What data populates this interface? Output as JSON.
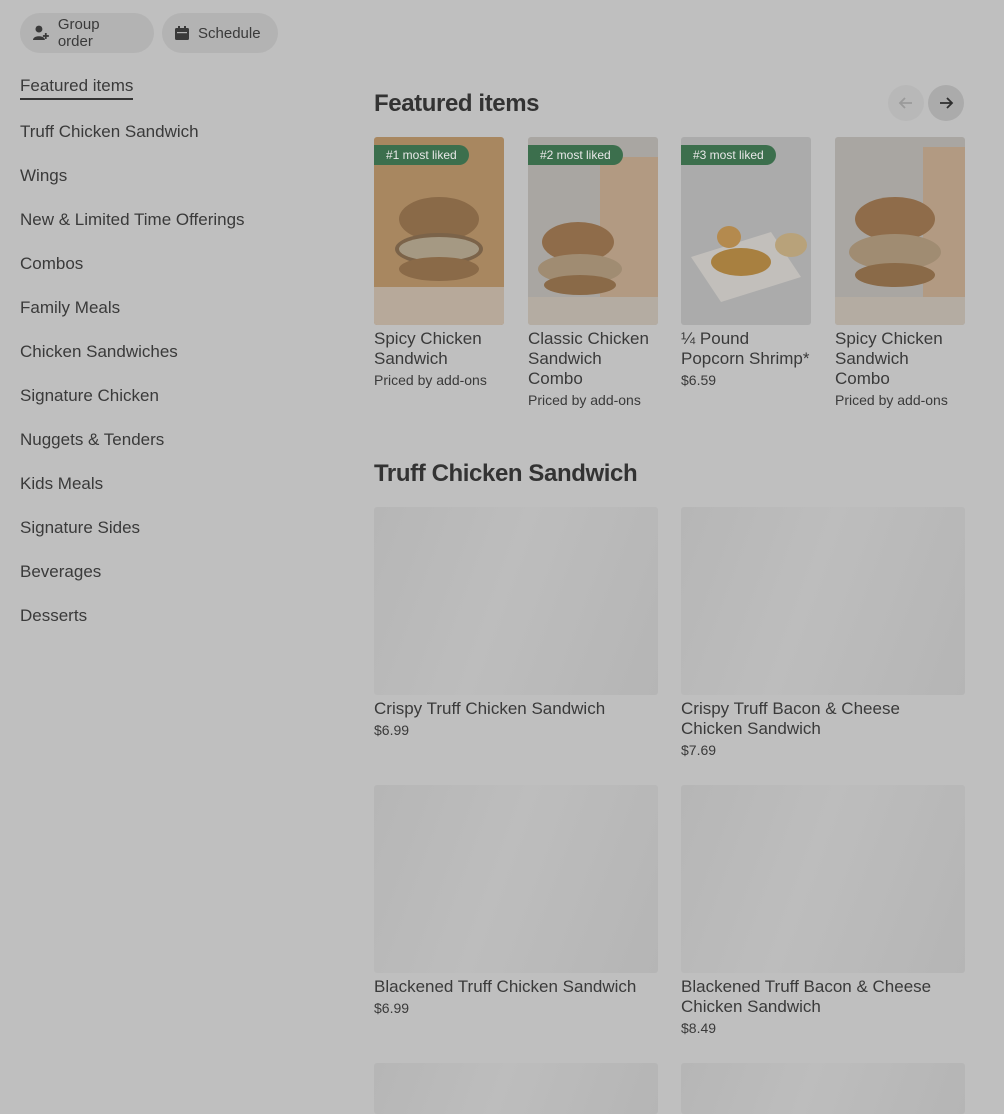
{
  "header": {
    "group_order_label": "Group order",
    "schedule_label": "Schedule"
  },
  "sidebar": {
    "items": [
      {
        "label": "Featured items",
        "active": true
      },
      {
        "label": "Truff Chicken Sandwich"
      },
      {
        "label": "Wings"
      },
      {
        "label": "New & Limited Time Offerings"
      },
      {
        "label": "Combos"
      },
      {
        "label": "Family Meals"
      },
      {
        "label": "Chicken Sandwiches"
      },
      {
        "label": "Signature Chicken"
      },
      {
        "label": "Nuggets & Tenders"
      },
      {
        "label": "Kids Meals"
      },
      {
        "label": "Signature Sides"
      },
      {
        "label": "Beverages"
      },
      {
        "label": "Desserts"
      }
    ]
  },
  "featured": {
    "title": "Featured items",
    "items": [
      {
        "badge": "#1 most liked",
        "name": "Spicy Chicken Sandwich",
        "price": "Priced by add-ons"
      },
      {
        "badge": "#2 most liked",
        "name": "Classic Chicken Sandwich Combo",
        "price": "Priced by add-ons"
      },
      {
        "badge": "#3 most liked",
        "name": "¼ Pound Popcorn Shrimp*",
        "price": "$6.59"
      },
      {
        "badge": "",
        "name": "Spicy Chicken Sandwich Combo",
        "price": "Priced by add-ons"
      }
    ]
  },
  "section": {
    "title": "Truff Chicken Sandwich",
    "items": [
      {
        "name": "Crispy Truff Chicken Sandwich",
        "price": "$6.99"
      },
      {
        "name": "Crispy Truff Bacon & Cheese Chicken Sandwich",
        "price": "$7.69"
      },
      {
        "name": "Blackened Truff Chicken Sandwich",
        "price": "$6.99"
      },
      {
        "name": "Blackened Truff Bacon & Cheese Chicken Sandwich",
        "price": "$8.49"
      }
    ]
  },
  "colors": {
    "overlay_bg": "#bfbfbf",
    "badge_green": "#3c6f4d",
    "text": "#3a3a3a"
  }
}
